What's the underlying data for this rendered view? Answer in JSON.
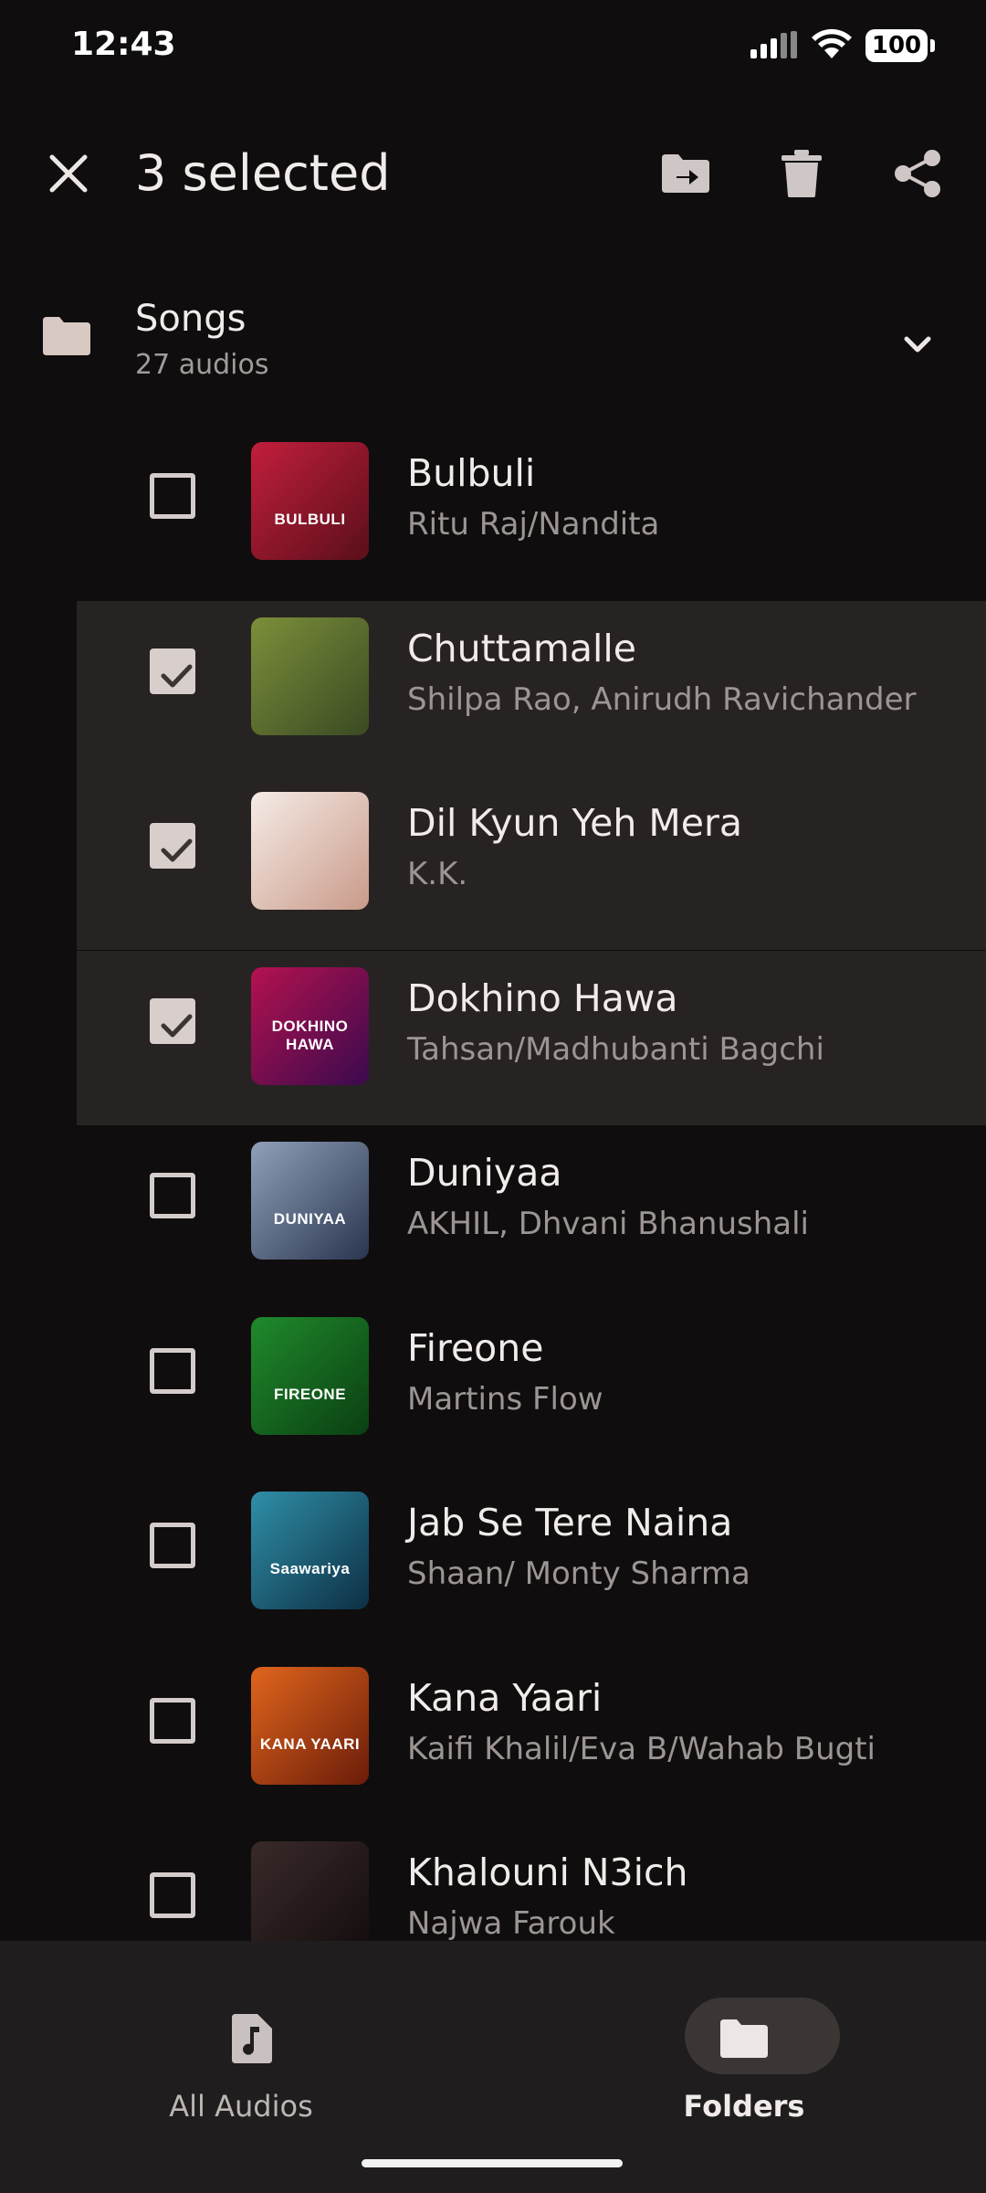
{
  "status": {
    "time": "12:43",
    "battery": "100"
  },
  "header": {
    "title": "3 selected",
    "close_icon": "close-icon",
    "move_icon": "move-to-folder-icon",
    "delete_icon": "delete-icon",
    "share_icon": "share-icon"
  },
  "folder": {
    "name": "Songs",
    "count": "27 audios"
  },
  "songs": [
    {
      "title": "Bulbuli",
      "artist": "Ritu Raj/Nandita",
      "selected": false,
      "art_text": "BULBULI",
      "colors": [
        "#c21e3c",
        "#5a0f1a"
      ]
    },
    {
      "title": "Chuttamalle",
      "artist": "Shilpa Rao, Anirudh Ravichander",
      "selected": true,
      "art_text": "",
      "colors": [
        "#7c8f3a",
        "#3a4a22"
      ]
    },
    {
      "title": "Dil Kyun Yeh Mera",
      "artist": "K.K.",
      "selected": true,
      "art_text": "",
      "colors": [
        "#f5ece6",
        "#c99a8a"
      ]
    },
    {
      "title": "Dokhino Hawa",
      "artist": "Tahsan/Madhubanti Bagchi",
      "selected": true,
      "art_text": "DOKHINO HAWA",
      "colors": [
        "#b4124f",
        "#3a0a4e"
      ]
    },
    {
      "title": "Duniyaa",
      "artist": "AKHIL, Dhvani Bhanushali",
      "selected": false,
      "art_text": "DUNIYAA",
      "colors": [
        "#8fa0b8",
        "#2a3550"
      ]
    },
    {
      "title": "Fireone",
      "artist": "Martins Flow",
      "selected": false,
      "art_text": "FIREONE",
      "colors": [
        "#1f8a2c",
        "#0b3f12"
      ]
    },
    {
      "title": "Jab Se Tere Naina",
      "artist": "Shaan/ Monty Sharma",
      "selected": false,
      "art_text": "Saawariya",
      "colors": [
        "#2f8fa8",
        "#0d2f44"
      ]
    },
    {
      "title": "Kana Yaari",
      "artist": "Kaifi Khalil/Eva B/Wahab Bugti",
      "selected": false,
      "art_text": "KANA YAARI",
      "colors": [
        "#e0651c",
        "#6b1c0a"
      ]
    },
    {
      "title": "Khalouni N3ich",
      "artist": "Najwa Farouk",
      "selected": false,
      "art_text": "",
      "colors": [
        "#3a2a2a",
        "#120c0c"
      ]
    }
  ],
  "nav": {
    "all_audios": "All Audios",
    "folders": "Folders"
  }
}
